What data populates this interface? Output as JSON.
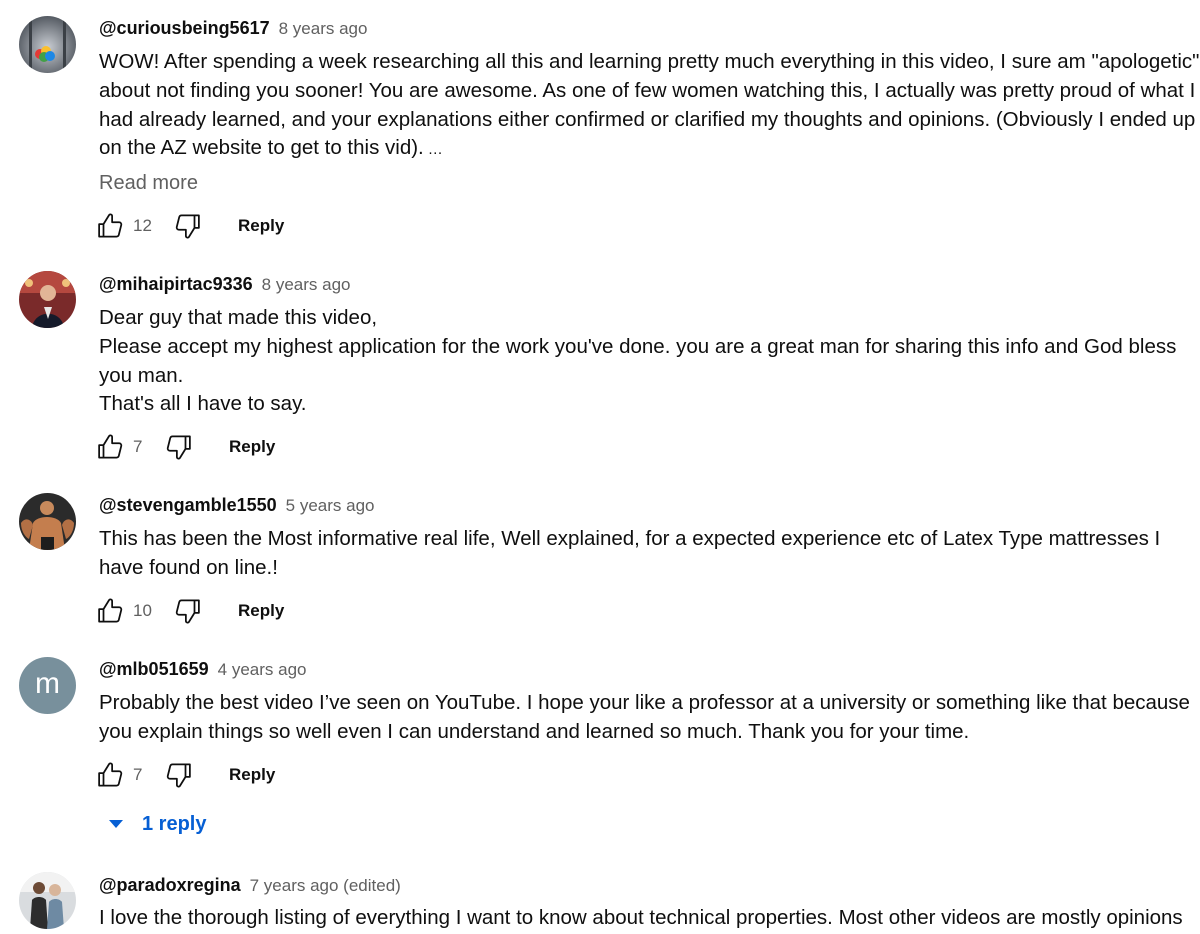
{
  "comments": [
    {
      "handle": "@curiousbeing5617",
      "time": "8 years ago",
      "text_lines": [
        "WOW! After spending a week researching all this and learning pretty much everything in this video, I sure am \"apologetic\"",
        "about not finding you sooner! You are awesome. As one of few women watching this, I actually was pretty proud of what I",
        "had already learned, and your explanations either confirmed or clarified my thoughts and opinions. (Obviously I ended up",
        "on the AZ website to get to this vid)."
      ],
      "ellipsis": "…",
      "read_more": "Read more",
      "likes": "12",
      "reply_label": "Reply"
    },
    {
      "handle": "@mihaipirtac9336",
      "time": "8 years ago",
      "text_lines": [
        "Dear guy that made this video,",
        "Please accept my highest application for the work you've done.  you are a great man for sharing this info and God bless",
        "you man.",
        "That's all I have to say."
      ],
      "likes": "7",
      "reply_label": "Reply"
    },
    {
      "handle": "@stevengamble1550",
      "time": "5 years ago",
      "text_lines": [
        "This has been the Most informative real life, Well explained, for a  expected experience etc of Latex Type mattresses I",
        "have found on line.!"
      ],
      "likes": "10",
      "reply_label": "Reply"
    },
    {
      "handle": "@mlb051659",
      "time": "4 years ago",
      "avatar_letter": "m",
      "text_lines": [
        "Probably the best video I’ve seen on YouTube. I hope your like a professor at a university or something like that because",
        "you explain things so well even I can understand and learned so much. Thank you for your time."
      ],
      "likes": "7",
      "reply_label": "Reply",
      "replies_label": "1 reply"
    },
    {
      "handle": "@paradoxregina",
      "time": "7 years ago (edited)",
      "text_lines": [
        "I love the thorough listing of everything I want to know about technical properties. Most other videos are mostly opinions"
      ]
    }
  ],
  "colors": {
    "text": "#0f0f0f",
    "secondary": "#606060",
    "link": "#065fd4",
    "letter_avatar_bg": "#78909c"
  },
  "icons": {
    "like": "thumb-up-outline-icon",
    "dislike": "thumb-down-outline-icon",
    "expand": "caret-down-icon"
  }
}
